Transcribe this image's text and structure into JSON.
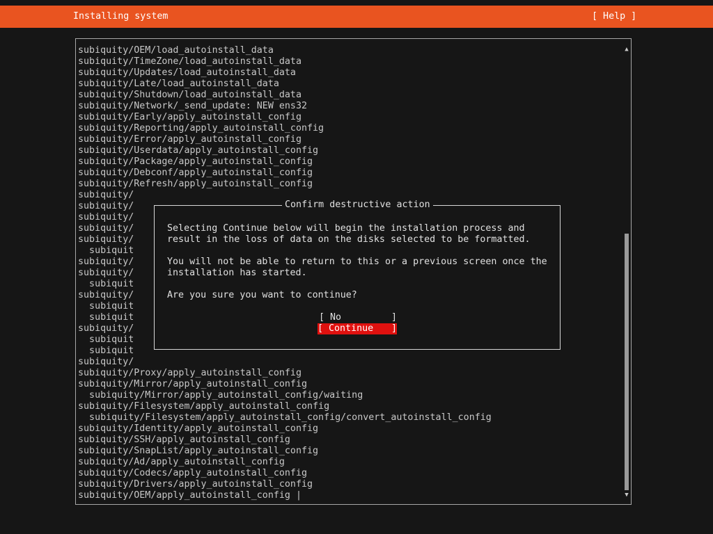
{
  "header": {
    "title": "Installing system",
    "help_label": "[ Help ]"
  },
  "log": {
    "lines": [
      "subiquity/OEM/load_autoinstall_data",
      "subiquity/TimeZone/load_autoinstall_data",
      "subiquity/Updates/load_autoinstall_data",
      "subiquity/Late/load_autoinstall_data",
      "subiquity/Shutdown/load_autoinstall_data",
      "subiquity/Network/_send_update: NEW ens32",
      "subiquity/Early/apply_autoinstall_config",
      "subiquity/Reporting/apply_autoinstall_config",
      "subiquity/Error/apply_autoinstall_config",
      "subiquity/Userdata/apply_autoinstall_config",
      "subiquity/Package/apply_autoinstall_config",
      "subiquity/Debconf/apply_autoinstall_config",
      "subiquity/Refresh/apply_autoinstall_config",
      "subiquity/",
      "subiquity/",
      "subiquity/",
      "subiquity/",
      "subiquity/",
      "  subiquit",
      "subiquity/",
      "subiquity/",
      "  subiquit",
      "subiquity/",
      "  subiquit",
      "  subiquit",
      "subiquity/",
      "  subiquit",
      "  subiquit",
      "subiquity/",
      "subiquity/Proxy/apply_autoinstall_config",
      "subiquity/Mirror/apply_autoinstall_config",
      "  subiquity/Mirror/apply_autoinstall_config/waiting",
      "subiquity/Filesystem/apply_autoinstall_config",
      "  subiquity/Filesystem/apply_autoinstall_config/convert_autoinstall_config",
      "subiquity/Identity/apply_autoinstall_config",
      "subiquity/SSH/apply_autoinstall_config",
      "subiquity/SnapList/apply_autoinstall_config",
      "subiquity/Ad/apply_autoinstall_config",
      "subiquity/Codecs/apply_autoinstall_config",
      "subiquity/Drivers/apply_autoinstall_config",
      "subiquity/OEM/apply_autoinstall_config |"
    ]
  },
  "scrollbar": {
    "up_icon": "▲",
    "down_icon": "▼",
    "position_fraction": 1.0
  },
  "dialog": {
    "title": "Confirm destructive action",
    "body": [
      "Selecting Continue below will begin the installation process and",
      "result in the loss of data on the disks selected to be formatted.",
      "",
      "You will not be able to return to this or a previous screen once the",
      "installation has started.",
      "",
      "Are you sure you want to continue?"
    ],
    "buttons": {
      "no": {
        "left_bracket": "[",
        "label": "No",
        "right_bracket": "]"
      },
      "continue": {
        "left_bracket": "[",
        "label": "Continue",
        "right_bracket": "]",
        "selected": true
      }
    }
  },
  "colors": {
    "header_bg": "#e95420",
    "screen_bg": "#161616",
    "selected_button_bg": "#e0110f"
  }
}
